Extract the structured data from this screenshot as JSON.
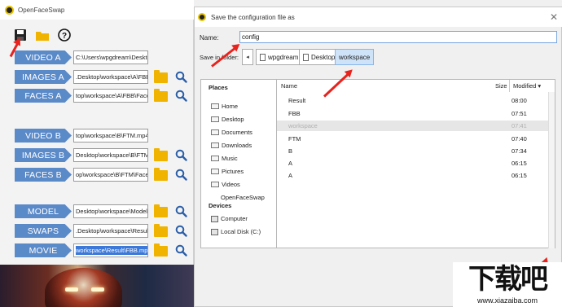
{
  "app": {
    "title": "OpenFaceSwap",
    "rows": [
      {
        "label": "VIDEO A",
        "value": "C:\\Users\\wpgdream\\Deskto",
        "folder": false
      },
      {
        "label": "IMAGES A",
        "value": ".Desktop\\workspace\\A\\FBB",
        "folder": true
      },
      {
        "label": "FACES A",
        "value": "top\\workspace\\A\\FBB\\Face",
        "folder": true
      },
      {
        "label": "VIDEO B",
        "value": "top\\workspace\\B\\FTM.mp4",
        "folder": false
      },
      {
        "label": "IMAGES B",
        "value": "Desktop\\workspace\\B\\FTM",
        "folder": true
      },
      {
        "label": "FACES B",
        "value": "op\\workspace\\B\\FTM\\Face",
        "folder": true
      },
      {
        "label": "MODEL",
        "value": "Desktop\\workspace\\Model",
        "folder": true
      },
      {
        "label": "SWAPS",
        "value": ".Desktop\\workspace\\Result",
        "folder": true
      },
      {
        "label": "MOVIE",
        "value": "workspace\\Result\\FBB.mp4",
        "folder": true
      }
    ]
  },
  "dialog": {
    "title": "Save the configuration file as",
    "close": "✕",
    "name_label": "Name:",
    "name_value": "config",
    "save_in_label": "Save in folder:",
    "back": "◂",
    "crumbs": [
      "wpgdream",
      "Desktop",
      "workspace"
    ],
    "places_header": "Places",
    "places": [
      "Home",
      "Desktop",
      "Documents",
      "Downloads",
      "Music",
      "Pictures",
      "Videos",
      "OpenFaceSwap"
    ],
    "devices_header": "Devices",
    "devices": [
      "Computer",
      "Local Disk (C:)"
    ],
    "columns": {
      "name": "Name",
      "size": "Size",
      "modified": "Modified ▾"
    },
    "files": [
      {
        "name": "Result",
        "time": "08:00",
        "dim": false
      },
      {
        "name": "FBB",
        "time": "07:51",
        "dim": false
      },
      {
        "name": "workspace",
        "time": "07:41",
        "dim": true
      },
      {
        "name": "FTM",
        "time": "07:40",
        "dim": false
      },
      {
        "name": "B",
        "time": "07:34",
        "dim": false
      },
      {
        "name": "A",
        "time": "06:15",
        "dim": false
      },
      {
        "name": "A",
        "time": "06:15",
        "dim": false
      }
    ]
  },
  "watermark": {
    "glyph": "下载吧",
    "url": "www.xiazaiba.com"
  },
  "colors": {
    "accent": "#5b8ac9",
    "arrow": "#e8221d",
    "folder": "#f0b400"
  }
}
